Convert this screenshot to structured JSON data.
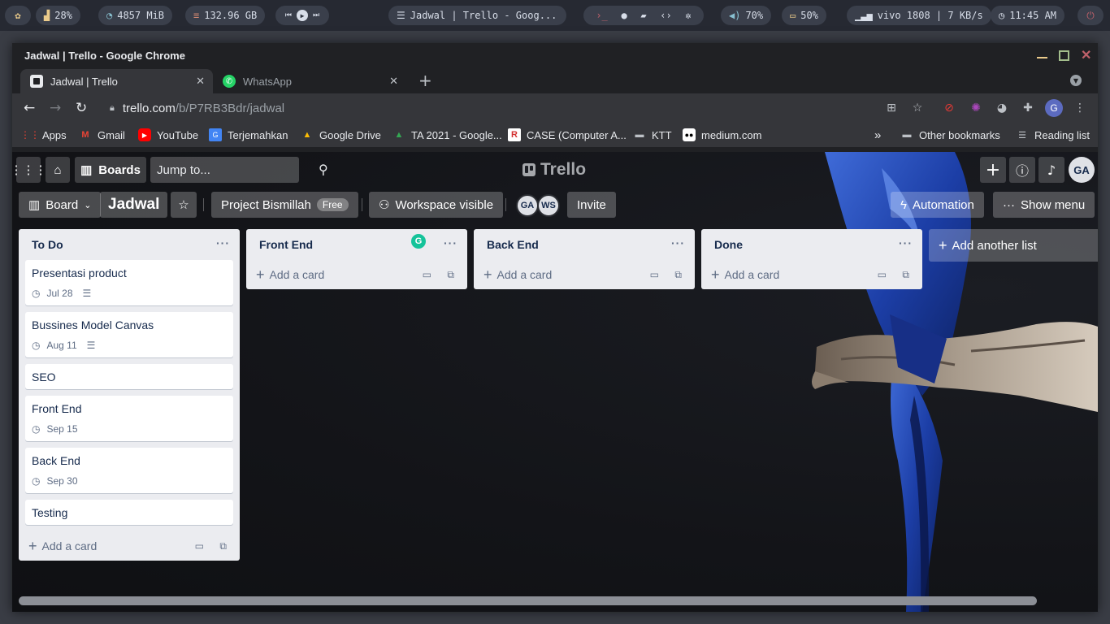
{
  "sysbar": {
    "cpu": "28%",
    "memory": "4857 MiB",
    "disk": "132.96 GB",
    "window_title": "Jadwal | Trello - Goog...",
    "volume": "70%",
    "battery": "50%",
    "network": "vivo 1808 | 7 KB/s",
    "clock": "11:45 AM"
  },
  "window": {
    "title": "Jadwal | Trello - Google Chrome"
  },
  "tabs": [
    {
      "label": "Jadwal | Trello"
    },
    {
      "label": "WhatsApp"
    }
  ],
  "address": {
    "host": "trello.com",
    "path": "/b/P7RB3Bdr/jadwal"
  },
  "bookmarks": [
    {
      "label": "Apps"
    },
    {
      "label": "Gmail"
    },
    {
      "label": "YouTube"
    },
    {
      "label": "Terjemahkan"
    },
    {
      "label": "Google Drive"
    },
    {
      "label": "TA 2021 - Google..."
    },
    {
      "label": "CASE (Computer A..."
    },
    {
      "label": "KTT"
    },
    {
      "label": "medium.com"
    },
    {
      "label": "Other bookmarks"
    },
    {
      "label": "Reading list"
    }
  ],
  "trello": {
    "boards_label": "Boards",
    "search_placeholder": "Jump to...",
    "logo": "Trello",
    "account_initials": "GA",
    "view_label": "Board",
    "board_title": "Jadwal",
    "workspace_name": "Project Bismillah",
    "workspace_badge": "Free",
    "visibility_label": "Workspace visible",
    "members": [
      "GA",
      "WS"
    ],
    "invite_label": "Invite",
    "automation_label": "Automation",
    "show_menu_label": "Show menu",
    "add_card_label": "Add a card",
    "add_list_label": "Add another list",
    "lists": [
      {
        "title": "To Do",
        "cards": [
          {
            "title": "Presentasi product",
            "due": "Jul 28"
          },
          {
            "title": "Bussines Model Canvas",
            "due": "Aug 11"
          },
          {
            "title": "SEO"
          },
          {
            "title": "Front End",
            "due": "Sep 15"
          },
          {
            "title": "Back End",
            "due": "Sep 30"
          },
          {
            "title": "Testing"
          }
        ]
      },
      {
        "title": "Front End",
        "cards": []
      },
      {
        "title": "Back End",
        "cards": []
      },
      {
        "title": "Done",
        "cards": []
      }
    ]
  }
}
